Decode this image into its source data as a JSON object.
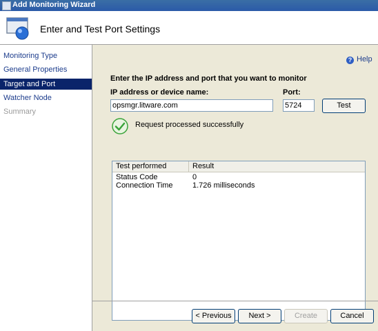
{
  "window": {
    "title": "Add Monitoring Wizard"
  },
  "header": {
    "title": "Enter and Test Port Settings"
  },
  "sidebar": {
    "items": [
      {
        "label": "Monitoring Type",
        "state": "normal"
      },
      {
        "label": "General Properties",
        "state": "normal"
      },
      {
        "label": "Target and Port",
        "state": "active"
      },
      {
        "label": "Watcher Node",
        "state": "normal"
      },
      {
        "label": "Summary",
        "state": "disabled"
      }
    ]
  },
  "help": {
    "label": "Help",
    "icon": "help-icon"
  },
  "form": {
    "heading": "Enter the IP address and port that you want to monitor",
    "ip_label": "IP address or device name:",
    "ip_value": "opsmgr.litware.com",
    "port_label": "Port:",
    "port_value": "5724",
    "test_label": "Test"
  },
  "status": {
    "icon": "check-icon",
    "message": "Request processed successfully"
  },
  "results": {
    "columns": [
      "Test performed",
      "Result"
    ],
    "rows": [
      [
        "Status Code",
        "0"
      ],
      [
        "Connection Time",
        "1.726 milliseconds"
      ]
    ]
  },
  "buttons": {
    "previous": "< Previous",
    "next": "Next >",
    "create": "Create",
    "cancel": "Cancel"
  },
  "colors": {
    "selection": "#0a246a",
    "link": "#1c3c8c",
    "success": "#3aa33a"
  }
}
